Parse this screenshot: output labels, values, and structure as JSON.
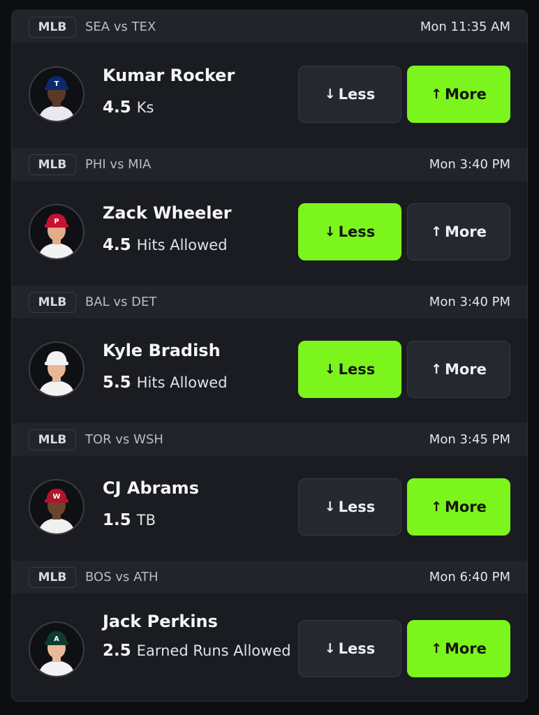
{
  "picks": [
    {
      "league": "MLB",
      "matchup": "SEA vs TEX",
      "time": "Mon 11:35 AM",
      "player": "Kumar Rocker",
      "line": "4.5",
      "stat": "Ks",
      "less_label": "Less",
      "more_label": "More",
      "selected": "more",
      "cap_color": "#0b2a6b",
      "cap_letter": "T",
      "skin": "#5a3a26",
      "jersey": "#e8e8ee"
    },
    {
      "league": "MLB",
      "matchup": "PHI vs MIA",
      "time": "Mon 3:40 PM",
      "player": "Zack Wheeler",
      "line": "4.5",
      "stat": "Hits Allowed",
      "less_label": "Less",
      "more_label": "More",
      "selected": "less",
      "cap_color": "#c41230",
      "cap_letter": "P",
      "skin": "#e0ad8a",
      "jersey": "#f1f1f1"
    },
    {
      "league": "MLB",
      "matchup": "BAL vs DET",
      "time": "Mon 3:40 PM",
      "player": "Kyle Bradish",
      "line": "5.5",
      "stat": "Hits Allowed",
      "less_label": "Less",
      "more_label": "More",
      "selected": "less",
      "cap_color": "#f2f2f2",
      "cap_letter": "",
      "skin": "#e7b796",
      "jersey": "#f3f3f3"
    },
    {
      "league": "MLB",
      "matchup": "TOR vs WSH",
      "time": "Mon 3:45 PM",
      "player": "CJ Abrams",
      "line": "1.5",
      "stat": "TB",
      "less_label": "Less",
      "more_label": "More",
      "selected": "more",
      "cap_color": "#b0152a",
      "cap_letter": "W",
      "skin": "#6b4530",
      "jersey": "#f0f0f0"
    },
    {
      "league": "MLB",
      "matchup": "BOS vs ATH",
      "time": "Mon 6:40 PM",
      "player": "Jack Perkins",
      "line": "2.5",
      "stat": "Earned Runs Allowed",
      "less_label": "Less",
      "more_label": "More",
      "selected": "more",
      "cap_color": "#0f3b2e",
      "cap_letter": "A",
      "skin": "#e9b99a",
      "jersey": "#f2f2f2"
    }
  ],
  "icons": {
    "less": "arrow-down-icon",
    "more": "arrow-up-icon"
  },
  "colors": {
    "selected": "#7bf51c",
    "unselected": "#262830",
    "background": "#1a1c22",
    "header": "#22242b"
  }
}
